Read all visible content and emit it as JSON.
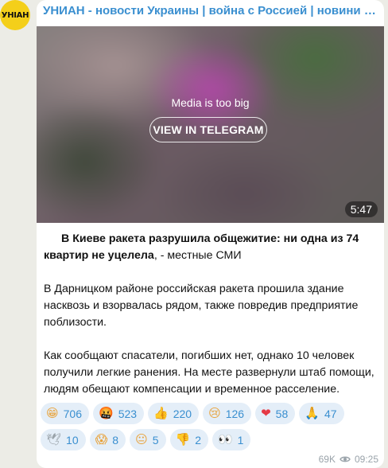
{
  "avatar": {
    "text": "УНІАН"
  },
  "channel": {
    "title": "УНИАН - новости Украины | война с Россией | новини Украї..."
  },
  "media": {
    "caption": "Media is too big",
    "button_label": "VIEW IN TELEGRAM",
    "duration": "5:47"
  },
  "post": {
    "headline_bold": "В Киеве ракета разрушила общежитие: ни одна из 74 квартир не уцелела",
    "headline_rest": ", - местные СМИ",
    "paragraph2": "В Дарницком районе российская ракета прошила здание насквозь и взорвалась рядом, также повредив предприятие поблизости.",
    "paragraph3": "Как сообщают спасатели, погибших нет, однако 10 человек получили легкие ранения. На месте развернули штаб помощи, людям обещают компенсации и временное расселение."
  },
  "reactions": {
    "row1": [
      {
        "icon": "grinning-face-icon",
        "glyph": "😁",
        "count": "706"
      },
      {
        "icon": "enraged-face-icon",
        "glyph": "🤬",
        "count": "523"
      },
      {
        "icon": "thumbs-up-icon",
        "glyph": "👍",
        "count": "220"
      },
      {
        "icon": "crying-face-icon",
        "glyph": "😢",
        "count": "126"
      },
      {
        "icon": "red-heart-icon",
        "glyph": "❤",
        "count": "58"
      },
      {
        "icon": "folded-hands-icon",
        "glyph": "🙏",
        "count": "47"
      }
    ],
    "row2": [
      {
        "icon": "dove-icon",
        "glyph": "🕊",
        "count": "10"
      },
      {
        "icon": "screaming-face-icon",
        "glyph": "😱",
        "count": "8"
      },
      {
        "icon": "neutral-face-icon",
        "glyph": "😐",
        "count": "5"
      },
      {
        "icon": "thumbs-down-icon",
        "glyph": "👎",
        "count": "2"
      },
      {
        "icon": "eyes-icon",
        "glyph": "👀",
        "count": "1"
      }
    ]
  },
  "meta": {
    "views": "69K",
    "time": "09:25",
    "views_icon": "eye-icon"
  },
  "colors": {
    "accent": "#3a8fd0",
    "chip_bg": "#e4eef8",
    "avatar_bg": "#f4cf1a",
    "page_bg": "#ecece6"
  }
}
